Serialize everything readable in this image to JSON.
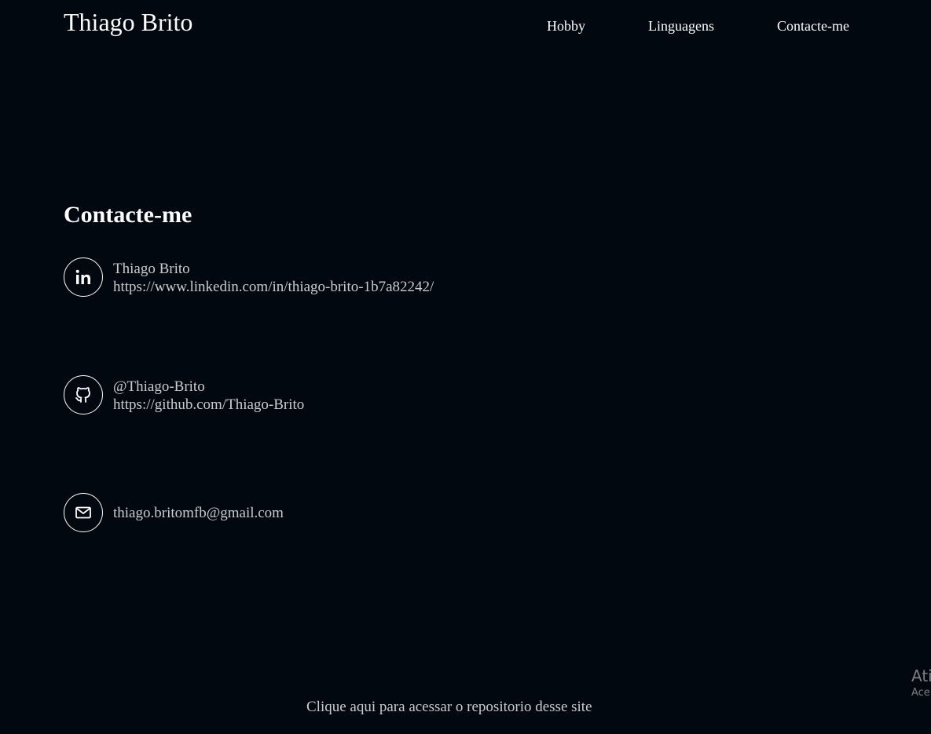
{
  "header": {
    "brand": "Thiago Brito",
    "nav": {
      "hobby": "Hobby",
      "languages": "Linguagens",
      "contact": "Contacte-me"
    }
  },
  "contact_section": {
    "title": "Contacte-me",
    "items": [
      {
        "icon": "linkedin-icon",
        "name": "Thiago Brito",
        "url": "https://www.linkedin.com/in/thiago-brito-1b7a82242/"
      },
      {
        "icon": "github-icon",
        "name": "@Thiago-Brito",
        "url": "https://github.com/Thiago-Brito"
      },
      {
        "icon": "mail-icon",
        "email": "thiago.britomfb@gmail.com"
      }
    ]
  },
  "footer": {
    "repo_link": "Clique aqui para acessar o repositorio desse site"
  },
  "watermark": {
    "title": "Ati",
    "subtitle": "Ace"
  },
  "colors": {
    "background": "#02080f",
    "text": "#ffffff",
    "muted_text": "#c9ccd0"
  }
}
